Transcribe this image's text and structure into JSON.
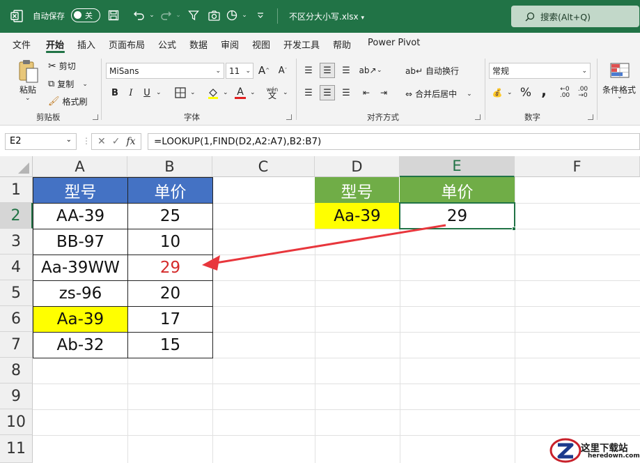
{
  "titlebar": {
    "autosave_label": "自动保存",
    "autosave_state": "关",
    "file_name": "不区分大小写.xlsx",
    "search_placeholder": "搜索(Alt+Q)",
    "accent_color": "#217346"
  },
  "menu": {
    "items": [
      "文件",
      "开始",
      "插入",
      "页面布局",
      "公式",
      "数据",
      "审阅",
      "视图",
      "开发工具",
      "帮助",
      "Power Pivot"
    ],
    "active": "开始"
  },
  "ribbon": {
    "clipboard": {
      "paste": "粘贴",
      "cut": "剪切",
      "copy": "复制",
      "format_painter": "格式刷",
      "label": "剪贴板"
    },
    "font": {
      "font_name": "MiSans",
      "font_size": "11",
      "bold": "B",
      "italic": "I",
      "underline": "U",
      "label": "字体",
      "phonetic": "wén"
    },
    "alignment": {
      "wrap": "自动换行",
      "merge": "合并后居中",
      "label": "对齐方式"
    },
    "number": {
      "format": "常规",
      "percent": "%",
      "comma": ",",
      "label": "数字"
    },
    "styles": {
      "conditional": "条件格式"
    }
  },
  "formula_bar": {
    "name_box": "E2",
    "fx": "fx",
    "formula": "=LOOKUP(1,FIND(D2,A2:A7),B2:B7)"
  },
  "grid": {
    "columns": [
      "A",
      "B",
      "C",
      "D",
      "E",
      "F"
    ],
    "rows": [
      "1",
      "2",
      "3",
      "4",
      "5",
      "6",
      "7",
      "8",
      "9",
      "10",
      "11"
    ],
    "selected_column": "E",
    "selected_row": "2",
    "table1": {
      "header_model": "型号",
      "header_price": "单价",
      "rows": [
        {
          "model": "AA-39",
          "price": "25"
        },
        {
          "model": "BB-97",
          "price": "10"
        },
        {
          "model": "Aa-39WW",
          "price": "29"
        },
        {
          "model": "zs-96",
          "price": "20"
        },
        {
          "model": "Aa-39",
          "price": "17"
        },
        {
          "model": "Ab-32",
          "price": "15"
        }
      ]
    },
    "table2": {
      "header_model": "型号",
      "header_price": "单价",
      "model": "Aa-39",
      "price": "29"
    },
    "colors": {
      "blue_header": "#4472c4",
      "green_header": "#70ad47",
      "highlight": "#ffff00",
      "red_value": "#d42a2a",
      "arrow": "#e8363c"
    }
  },
  "watermark": {
    "text": "这里下载站",
    "sub": "heredown.com"
  }
}
